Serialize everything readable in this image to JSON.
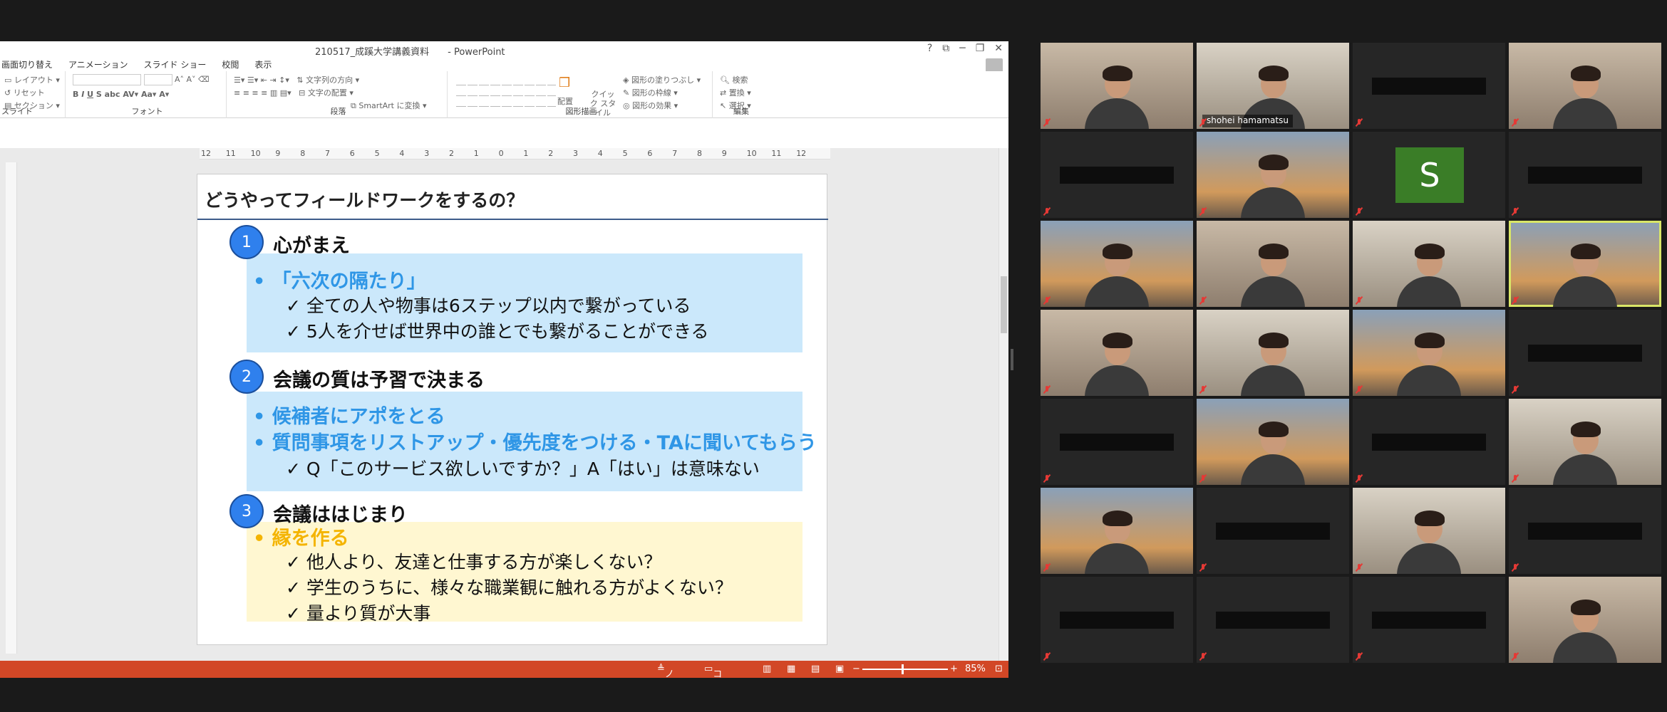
{
  "powerpoint": {
    "window_title": "210517_成蹊大学講義資料　　-  PowerPoint",
    "window_controls": [
      "?",
      "⧉",
      "─",
      "❐",
      "✕"
    ],
    "tabs": [
      "画面切り替え",
      "アニメーション",
      "スライド ショー",
      "校閲",
      "表示"
    ],
    "ribbon": {
      "slides_group": {
        "label": "スライド",
        "layout": "レイアウト",
        "reset": "リセット",
        "section": "セクション"
      },
      "font_group": {
        "label": "フォント"
      },
      "paragraph_group": {
        "label": "段落",
        "text_direction": "文字列の方向",
        "align_text": "文字の配置",
        "smartart": "SmartArt に変換"
      },
      "drawing_group": {
        "label": "図形描画",
        "arrange": "配置",
        "quick_styles": "クイック スタイル",
        "shape_fill": "図形の塗りつぶし",
        "shape_outline": "図形の枠線",
        "shape_effects": "図形の効果"
      },
      "editing_group": {
        "label": "編集",
        "find": "検索",
        "replace": "置換",
        "select": "選択"
      }
    },
    "ruler_h": [
      "12",
      "11",
      "10",
      "9",
      "8",
      "7",
      "6",
      "5",
      "4",
      "3",
      "2",
      "1",
      "0",
      "1",
      "2",
      "3",
      "4",
      "5",
      "6",
      "7",
      "8",
      "9",
      "10",
      "11",
      "12"
    ],
    "slide": {
      "title": "どうやってフィールドワークをするの？",
      "sections": [
        {
          "num": "1",
          "heading": "心がまえ",
          "bullets": [
            "「六次の隔たり」"
          ],
          "checks": [
            "✓ 全ての人や物事は6ステップ以内で繋がっている",
            "✓ 5人を介せば世界中の誰とでも繋がることができる"
          ]
        },
        {
          "num": "2",
          "heading": "会議の質は予習で決まる",
          "bullets": [
            "候補者にアポをとる",
            "質問事項をリストアップ・優先度をつける・TAに聞いてもらう"
          ],
          "checks": [
            "✓ Q「このサービス欲しいですか？」A「はい」は意味ない"
          ]
        },
        {
          "num": "3",
          "heading": "会議ははじまり",
          "bullets": [
            "縁を作る"
          ],
          "checks": [
            "✓ 他人より、友達と仕事する方が楽しくない？",
            "✓ 学生のうちに、様々な職業観に触れる方がよくない？",
            "✓ 量より質が大事"
          ]
        }
      ]
    },
    "statusbar": {
      "notes": "ノート",
      "comments": "コメント",
      "zoom": "85%"
    }
  },
  "gallery": {
    "participants": [
      {
        "name": "",
        "video": true
      },
      {
        "name": "shohei hamamatsu",
        "video": true
      },
      {
        "name": "",
        "video": false
      },
      {
        "name": "",
        "video": true
      },
      {
        "name": "",
        "video": false
      },
      {
        "name": "",
        "video": true
      },
      {
        "name": "S",
        "video": false,
        "avatar": true
      },
      {
        "name": "",
        "video": false
      },
      {
        "name": "",
        "video": true
      },
      {
        "name": "",
        "video": true
      },
      {
        "name": "",
        "video": true
      },
      {
        "name": "",
        "video": true,
        "active": true
      },
      {
        "name": "",
        "video": true
      },
      {
        "name": "",
        "video": true
      },
      {
        "name": "",
        "video": true
      },
      {
        "name": "",
        "video": false
      },
      {
        "name": "",
        "video": false
      },
      {
        "name": "",
        "video": true
      },
      {
        "name": "",
        "video": false
      },
      {
        "name": "",
        "video": true
      },
      {
        "name": "",
        "video": true
      },
      {
        "name": "",
        "video": false
      },
      {
        "name": "",
        "video": true
      },
      {
        "name": "",
        "video": false
      },
      {
        "name": "",
        "video": false
      },
      {
        "name": "",
        "video": false
      },
      {
        "name": "",
        "video": false
      },
      {
        "name": "",
        "video": true
      }
    ]
  }
}
